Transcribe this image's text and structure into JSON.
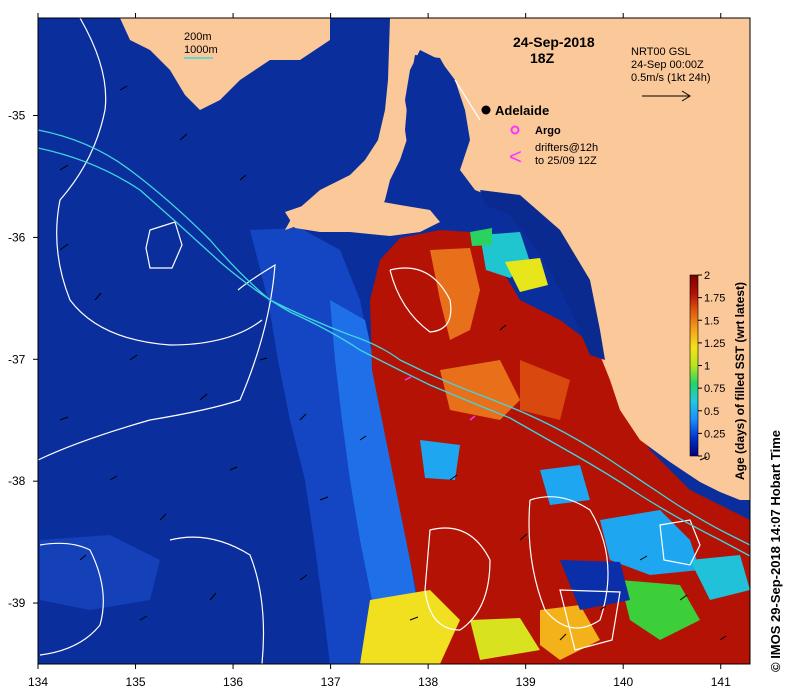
{
  "map": {
    "date": "24-Sep-2018",
    "time": "18Z",
    "place": "Adelaide",
    "depth_contours": [
      "200m",
      "1000m"
    ],
    "argo_label": "Argo",
    "drifters_label": [
      "drifters@12h",
      "to 25/09 12Z"
    ],
    "drifter_symbol": "<",
    "current_source": [
      "NRT00 GSL",
      "24-Sep 00:00Z",
      "0.5m/s (1kt 24h)"
    ],
    "credit": "© IMOS 29-Sep-2018 14:07 Hobart Time",
    "colors": {
      "ocean_base": "#0a2f9c",
      "land": "#fbc899",
      "contour_200m": "#ffffff",
      "contour_1000m": "#3fd6e0",
      "argo": "#ff33ff",
      "drifter": "#ff33ff"
    }
  },
  "axes": {
    "x_ticks": [
      "134",
      "135",
      "136",
      "137",
      "138",
      "139",
      "140",
      "141"
    ],
    "y_ticks": [
      "-35",
      "-36",
      "-37",
      "-38",
      "-39"
    ],
    "xlim": [
      134,
      141.3
    ],
    "ylim": [
      -39.5,
      -34.2
    ]
  },
  "colorbar": {
    "title": "Age (days) of filled SST (wrt latest)",
    "ticks": [
      "2",
      "1.75",
      "1.5",
      "1.25",
      "1",
      "0.75",
      "0.5",
      "0.25",
      "0"
    ],
    "range": [
      0,
      2
    ],
    "stops": [
      "#00007f",
      "#0033cc",
      "#1a8cff",
      "#22c8e0",
      "#22d46a",
      "#b7e61a",
      "#f5e11a",
      "#f5a01a",
      "#e05a0f",
      "#b01005",
      "#7a0000"
    ]
  }
}
